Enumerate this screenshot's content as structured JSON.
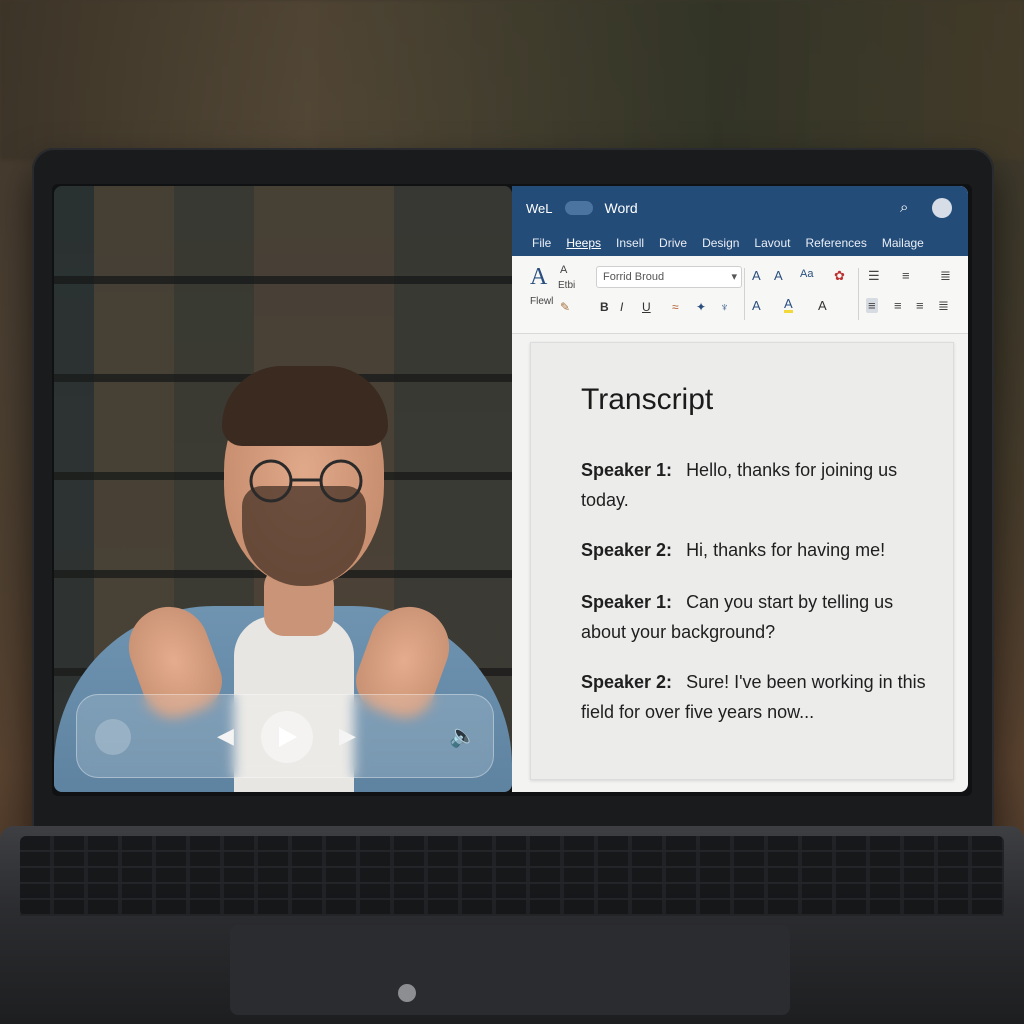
{
  "word": {
    "app_label": "WeL",
    "title": "Word",
    "menu": [
      "File",
      "Heeps",
      "Insell",
      "Drive",
      "Design",
      "Lavout",
      "References",
      "Mailage"
    ],
    "ribbon": {
      "style_label": "Etbi",
      "new_style_label": "Flewl",
      "font_name": "Forrid Broud"
    }
  },
  "document": {
    "title": "Transcript",
    "entries": [
      {
        "speaker": "Speaker 1:",
        "text": "Hello, thanks for joining us today."
      },
      {
        "speaker": "Speaker 2:",
        "text": "Hi, thanks for having me!"
      },
      {
        "speaker": "Speaker 1:",
        "text": "Can you start by telling us about your background?"
      },
      {
        "speaker": "Speaker 2:",
        "text": "Sure! I've been working in this field for over five years now..."
      }
    ]
  },
  "player": {
    "controls": [
      "prev-icon",
      "play-icon",
      "next-icon",
      "volume-icon"
    ]
  },
  "colors": {
    "word_header": "#244c79",
    "shirt": "#6f94b1"
  }
}
